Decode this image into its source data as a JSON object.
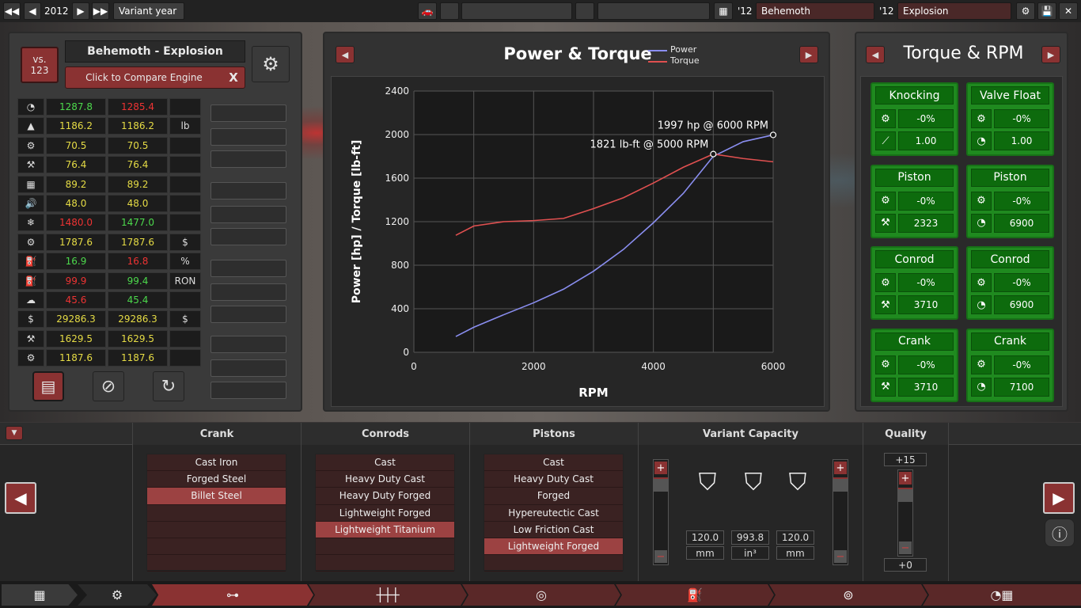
{
  "topbar": {
    "year": "2012",
    "variant_year_label": "Variant year",
    "left_model_year": "'12",
    "left_model_name": "Behemoth",
    "right_model_year": "'12",
    "right_model_name": "Explosion"
  },
  "left_panel": {
    "vs_label": "vs.",
    "vs_number": "123",
    "engine_title": "Behemoth - Explosion",
    "compare_label": "Click to Compare Engine",
    "compare_close": "X",
    "stats": [
      {
        "icon": "speedometer-icon",
        "glyph": "◔",
        "a": "1287.8",
        "a_color": "green",
        "b": "1285.4",
        "b_color": "red",
        "unit": ""
      },
      {
        "icon": "weight-icon",
        "glyph": "▲",
        "a": "1186.2",
        "a_color": "yellow",
        "b": "1186.2",
        "b_color": "yellow",
        "unit": "lb"
      },
      {
        "icon": "engine-smooth-icon",
        "glyph": "⚙",
        "a": "70.5",
        "a_color": "yellow",
        "b": "70.5",
        "b_color": "yellow",
        "unit": ""
      },
      {
        "icon": "wrench-icon",
        "glyph": "⚒",
        "a": "76.4",
        "a_color": "yellow",
        "b": "76.4",
        "b_color": "yellow",
        "unit": ""
      },
      {
        "icon": "engine-block-icon",
        "glyph": "▦",
        "a": "89.2",
        "a_color": "yellow",
        "b": "89.2",
        "b_color": "yellow",
        "unit": ""
      },
      {
        "icon": "noise-icon",
        "glyph": "🔊",
        "a": "48.0",
        "a_color": "yellow",
        "b": "48.0",
        "b_color": "yellow",
        "unit": ""
      },
      {
        "icon": "cooling-icon",
        "glyph": "❄",
        "a": "1480.0",
        "a_color": "red",
        "b": "1477.0",
        "b_color": "green",
        "unit": ""
      },
      {
        "icon": "cost-icon",
        "glyph": "⚙",
        "a": "1787.6",
        "a_color": "yellow",
        "b": "1787.6",
        "b_color": "yellow",
        "unit": "$"
      },
      {
        "icon": "efficiency-icon",
        "glyph": "⛽",
        "a": "16.9",
        "a_color": "green",
        "b": "16.8",
        "b_color": "red",
        "unit": "%"
      },
      {
        "icon": "fuel-pump-icon",
        "glyph": "⛽",
        "a": "99.9",
        "a_color": "red",
        "b": "99.4",
        "b_color": "green",
        "unit": "RON"
      },
      {
        "icon": "emissions-icon",
        "glyph": "☁",
        "a": "45.6",
        "a_color": "red",
        "b": "45.4",
        "b_color": "green",
        "unit": ""
      },
      {
        "icon": "money-bag-icon",
        "glyph": "$",
        "a": "29286.3",
        "a_color": "yellow",
        "b": "29286.3",
        "b_color": "yellow",
        "unit": "$"
      },
      {
        "icon": "anvil-icon",
        "glyph": "⚒",
        "a": "1629.5",
        "a_color": "yellow",
        "b": "1629.5",
        "b_color": "yellow",
        "unit": ""
      },
      {
        "icon": "gears-icon",
        "glyph": "⚙",
        "a": "1187.6",
        "a_color": "yellow",
        "b": "1187.6",
        "b_color": "yellow",
        "unit": ""
      }
    ]
  },
  "chart_panel": {
    "title": "Power & Torque",
    "legend_power": "Power",
    "legend_torque": "Torque",
    "power_color": "#8a8ef0",
    "torque_color": "#e05050"
  },
  "chart_data": {
    "type": "line",
    "xlabel": "RPM",
    "ylabel": "Power [hp] / Torque [lb-ft]",
    "xlim": [
      0,
      6000
    ],
    "ylim": [
      0,
      2400
    ],
    "xticks": [
      "0",
      "2000",
      "4000",
      "6000"
    ],
    "yticks": [
      "0",
      "400",
      "800",
      "1200",
      "1600",
      "2000",
      "2400"
    ],
    "grid": true,
    "series": [
      {
        "name": "Power",
        "x": [
          700,
          1000,
          1500,
          2000,
          2500,
          3000,
          3500,
          4000,
          4500,
          5000,
          5500,
          6000
        ],
        "values": [
          145,
          230,
          345,
          455,
          580,
          745,
          945,
          1190,
          1460,
          1800,
          1935,
          1997
        ]
      },
      {
        "name": "Torque",
        "x": [
          700,
          1000,
          1500,
          2000,
          2500,
          3000,
          3500,
          4000,
          4500,
          5000,
          5500,
          6000
        ],
        "values": [
          1075,
          1160,
          1200,
          1210,
          1230,
          1320,
          1420,
          1555,
          1700,
          1821,
          1780,
          1750
        ]
      }
    ],
    "annotations": [
      {
        "text": "1997 hp @ 6000 RPM",
        "x": 6000,
        "y": 1997
      },
      {
        "text": "1821 lb-ft @ 5000 RPM",
        "x": 5000,
        "y": 1821
      }
    ]
  },
  "right_panel": {
    "title": "Torque & RPM",
    "cards": [
      {
        "title": "Knocking",
        "v1": "-0%",
        "v2": "1.00",
        "icon2": "needle-icon",
        "glyph2": "⟋"
      },
      {
        "title": "Valve Float",
        "v1": "-0%",
        "v2": "1.00",
        "icon2": "gauge-icon",
        "glyph2": "◔"
      },
      {
        "title": "Piston",
        "v1": "-0%",
        "v2": "2323",
        "icon2": "wrench-icon",
        "glyph2": "⚒"
      },
      {
        "title": "Piston",
        "v1": "-0%",
        "v2": "6900",
        "icon2": "gauge-icon",
        "glyph2": "◔"
      },
      {
        "title": "Conrod",
        "v1": "-0%",
        "v2": "3710",
        "icon2": "wrench-icon",
        "glyph2": "⚒"
      },
      {
        "title": "Conrod",
        "v1": "-0%",
        "v2": "6900",
        "icon2": "gauge-icon",
        "glyph2": "◔"
      },
      {
        "title": "Crank",
        "v1": "-0%",
        "v2": "3710",
        "icon2": "wrench-icon",
        "glyph2": "⚒"
      },
      {
        "title": "Crank",
        "v1": "-0%",
        "v2": "7100",
        "icon2": "gauge-icon",
        "glyph2": "◔"
      }
    ]
  },
  "bottom": {
    "crank": {
      "header": "Crank",
      "items": [
        "Cast Iron",
        "Forged Steel",
        "Billet Steel",
        "",
        "",
        "",
        ""
      ],
      "selected": 2
    },
    "conrods": {
      "header": "Conrods",
      "items": [
        "Cast",
        "Heavy Duty Cast",
        "Heavy Duty Forged",
        "Lightweight Forged",
        "Lightweight Titanium",
        "",
        ""
      ],
      "selected": 4
    },
    "pistons": {
      "header": "Pistons",
      "items": [
        "Cast",
        "Heavy Duty Cast",
        "Forged",
        "Hypereutectic Cast",
        "Low Friction Cast",
        "Lightweight Forged",
        ""
      ],
      "selected": 5
    },
    "capacity": {
      "header": "Variant Capacity",
      "bore": "120.0",
      "bore_unit": "mm",
      "displacement": "993.8",
      "displacement_unit": "in³",
      "stroke": "120.0",
      "stroke_unit": "mm"
    },
    "quality": {
      "header": "Quality",
      "top": "+15",
      "bottom": "+0"
    }
  }
}
